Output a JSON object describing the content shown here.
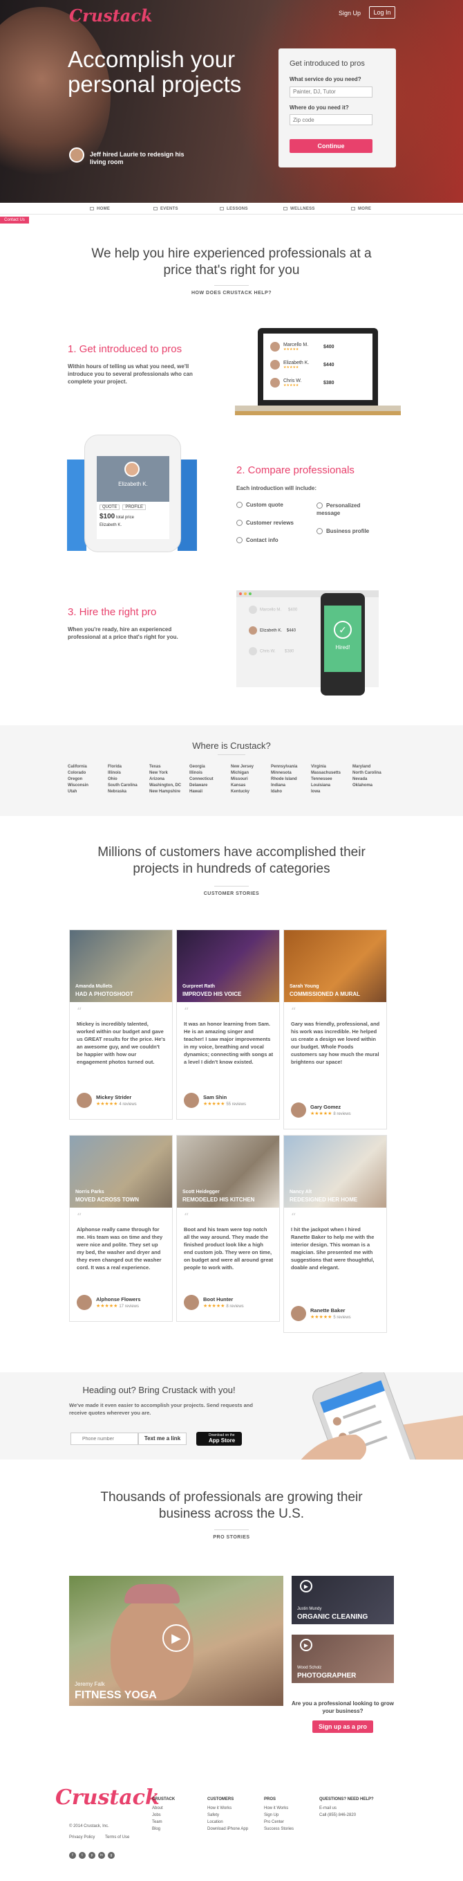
{
  "brand": {
    "logo_text": "Crustack",
    "accent": "#e8416c"
  },
  "header": {
    "signup": "Sign Up",
    "login": "Log In"
  },
  "hero": {
    "headline": "Accomplish your personal projects",
    "testimonial": "Jeff hired Laurie to redesign his living room"
  },
  "intro_form": {
    "title": "Get introduced to pros",
    "service_label": "What service do you need?",
    "service_placeholder": "Painter, DJ, Tutor",
    "where_label": "Where do you need it?",
    "where_placeholder": "Zip code",
    "button": "Continue"
  },
  "contact_tab": "Contact Us",
  "nav": [
    "HOME",
    "EVENTS",
    "LESSONS",
    "WELLNESS",
    "MORE"
  ],
  "how": {
    "title": "We help you hire experienced professionals at a price that's right for you",
    "subtitle": "HOW DOES CRUSTACK HELP?",
    "step1": {
      "title": "1. Get introduced to pros",
      "text": "Within hours of telling us what you need, we'll introduce you to several professionals who can complete your project.",
      "pros": [
        {
          "name": "Marcello M.",
          "price": "$400"
        },
        {
          "name": "Elizabeth K.",
          "price": "$440"
        },
        {
          "name": "Chris W.",
          "price": "$380"
        }
      ]
    },
    "step2": {
      "title": "2. Compare professionals",
      "intro": "Each introduction will include:",
      "features": [
        "Custom quote",
        "Personalized message",
        "Customer reviews",
        "Business profile",
        "Contact info"
      ],
      "phone_name": "Elizabeth K.",
      "quote_tab": "QUOTE",
      "profile_tab": "PROFILE",
      "quote_price": "$100",
      "quote_unit": "total price",
      "thread_name": "Elizabeth K."
    },
    "step3": {
      "title": "3. Hire the right pro",
      "text": "When you're ready, hire an experienced professional at a price that's right for you.",
      "rows": [
        {
          "name": "Marcello M.",
          "price": "$400"
        },
        {
          "name": "Elizabeth K.",
          "price": "$440"
        },
        {
          "name": "Chris W.",
          "price": "$380"
        }
      ],
      "hired_label": "Hired!"
    }
  },
  "where": {
    "title": "Where is Crustack?",
    "columns": [
      [
        "California",
        "Colorado",
        "Oregon",
        "Wisconsin",
        "Utah"
      ],
      [
        "Florida",
        "Illinois",
        "Ohio",
        "South Carolina",
        "Nebraska"
      ],
      [
        "Texas",
        "New York",
        "Arizona",
        "Washington, DC",
        "New Hampshire"
      ],
      [
        "Georgia",
        "Illinois",
        "Connecticut",
        "Delaware",
        "Hawaii"
      ],
      [
        "New Jersey",
        "Michigan",
        "Missouri",
        "Kansas",
        "Kentucky"
      ],
      [
        "Pennsylvania",
        "Minnesota",
        "Rhode Island",
        "Indiana",
        "Idaho"
      ],
      [
        "Virginia",
        "Massachusetts",
        "Tennessee",
        "Louisiana",
        "Iowa"
      ],
      [
        "Maryland",
        "North Carolina",
        "Nevada",
        "Oklahoma"
      ]
    ]
  },
  "stories": {
    "title": "Millions of customers have accomplished their projects in hundreds of categories",
    "subtitle": "CUSTOMER STORIES",
    "cards": [
      {
        "name": "Amanda Mullets",
        "title": "HAD A PHOTOSHOOT",
        "quote": "Mickey is incredibly talented, worked within our budget and gave us GREAT results for the price. He's an awesome guy, and we couldn't be happier with how our engagement photos turned out.",
        "author": "Mickey Strider",
        "reviews": "4 reviews"
      },
      {
        "name": "Gurpreet Rath",
        "title": "IMPROVED HIS VOICE",
        "quote": "It was an honor learning from Sam. He is an amazing singer and teacher! I saw major improvements in my voice, breathing and vocal dynamics; connecting with songs at a level I didn't know existed.",
        "author": "Sam Shin",
        "reviews": "55 reviews"
      },
      {
        "name": "Sarah Young",
        "title": "COMMISSIONED A MURAL",
        "quote": "Gary was friendly, professional, and his work was incredible. He helped us create a design we loved within our budget. Whole Foods customers say how much the mural brightens our space!",
        "author": "Gary Gomez",
        "reviews": "8 reviews"
      },
      {
        "name": "Norris Parks",
        "title": "MOVED ACROSS TOWN",
        "quote": "Alphonse really came through for me. His team was on time and they were nice and polite. They set up my bed, the washer and dryer and they even changed out the washer cord. It was a real experience.",
        "author": "Alphonse Flowers",
        "reviews": "17 reviews"
      },
      {
        "name": "Scott Heidegger",
        "title": "REMODELED HIS KITCHEN",
        "quote": "Boot and his team were top notch all the way around. They made the finished product look like a high end custom job. They were on time, on budget and were all around great people to work with.",
        "author": "Boot Hunter",
        "reviews": "8 reviews"
      },
      {
        "name": "Nancy Alt",
        "title": "REDESIGNED HER HOME",
        "quote": "I hit the jackpot when I hired Ranette Baker to help me with the interior design. This woman is a magician. She presented me with suggestions that were thoughtful, doable and elegant.",
        "author": "Ranette Baker",
        "reviews": "5 reviews"
      }
    ]
  },
  "app": {
    "title": "Heading out? Bring Crustack with you!",
    "text": "We've made it even easier to accomplish your projects. Send requests and receive quotes wherever you are.",
    "phone_placeholder": "Phone number",
    "text_link": "Text me a link",
    "appstore_top": "Download on the",
    "appstore": "App Store"
  },
  "pros": {
    "title": "Thousands of professionals are growing their business across the U.S.",
    "subtitle": "PRO STORIES",
    "main": {
      "name": "Jeremy Falk",
      "title": "FITNESS YOGA"
    },
    "side": [
      {
        "name": "Justin Mundy",
        "title": "ORGANIC CLEANING"
      },
      {
        "name": "Wood Scholz",
        "title": "PHOTOGRAPHER"
      }
    ],
    "cta_text": "Are you a professional looking to grow your business?",
    "cta_button": "Sign up as a pro"
  },
  "footer": {
    "copyright": "© 2014 Crustack, Inc.",
    "privacy": "Privacy Policy",
    "terms": "Terms of Use",
    "cols": [
      {
        "head": "CRUSTACK",
        "items": [
          "About",
          "Jobs",
          "Team",
          "Blog"
        ]
      },
      {
        "head": "CUSTOMERS",
        "items": [
          "How it Works",
          "Safety",
          "Location",
          "Download iPhone App"
        ]
      },
      {
        "head": "PROS",
        "items": [
          "How it Works",
          "Sign Up",
          "Pro Center",
          "Success Stories"
        ]
      },
      {
        "head": "QUESTIONS? NEED HELP?",
        "items": [
          "E-mail us",
          "Call (855) 846-2820"
        ]
      }
    ],
    "social": [
      "f",
      "t",
      "p",
      "in",
      "g"
    ]
  }
}
